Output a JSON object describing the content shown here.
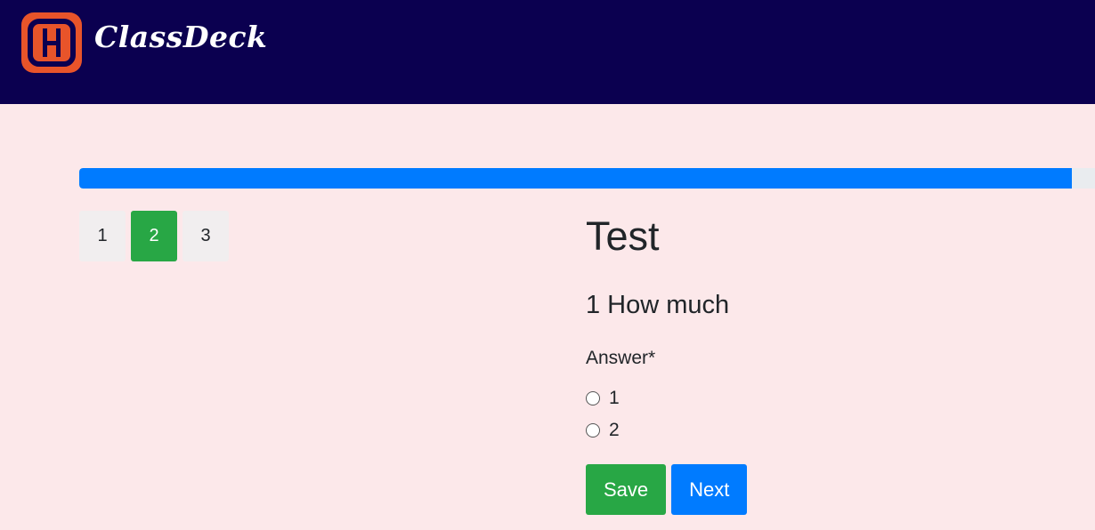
{
  "app": {
    "name": "ClassDeck"
  },
  "colors": {
    "navbar": "#0b0050",
    "logo": "#e8542a",
    "background": "#fce8ea",
    "primary": "#007bff",
    "success": "#28a745"
  },
  "progress": {
    "value_percent": 97.7
  },
  "pagination": {
    "pages": [
      "1",
      "2",
      "3"
    ],
    "active_index": 1
  },
  "quiz": {
    "title": "Test",
    "question": "1 How much",
    "answer_label": "Answer*",
    "options": [
      "1",
      "2"
    ]
  },
  "actions": {
    "save_label": "Save",
    "next_label": "Next"
  },
  "icons": {
    "logo": "classdeck-logo-icon",
    "option_marker": "radio-unchecked-icon"
  }
}
